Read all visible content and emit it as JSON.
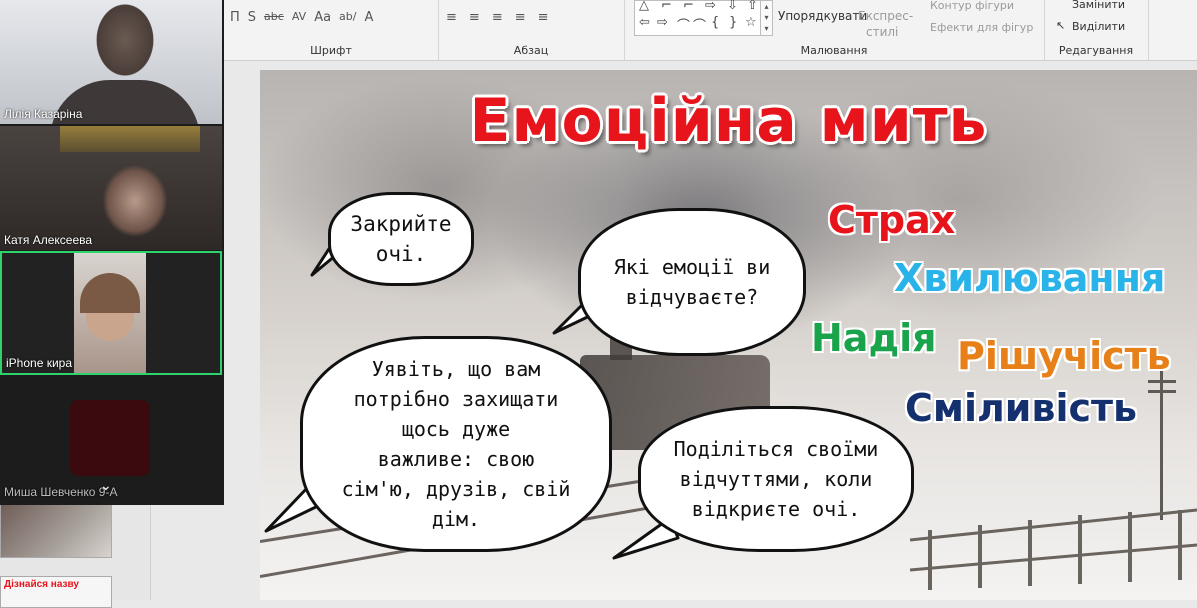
{
  "ribbon": {
    "font_tools": [
      "П",
      "S",
      "abc",
      "AV",
      "Aa",
      "ab/",
      "A"
    ],
    "para_tools": [
      "≡",
      "≡",
      "≡",
      "≡",
      "≡"
    ],
    "group_font": "Шрифт",
    "group_paragraph": "Абзац",
    "group_drawing": "Малювання",
    "group_editing": "Редагування",
    "arrange": "Упорядкувати",
    "styles_line1": "Експрес-",
    "styles_line2": "стилі",
    "outline": "Контур фігури",
    "effects": "Ефекти для фігур",
    "replace": "Замінити",
    "select": "Виділити",
    "shapes_glyphs": [
      "△",
      "⌐",
      "⌐",
      "⇨",
      "⇩",
      "⇧",
      "⇦",
      "⇨",
      "⌒",
      "⌒",
      "{",
      "}",
      "☆"
    ]
  },
  "slide": {
    "title": "Емоційна мить",
    "bubbles": {
      "close_eyes": [
        "Закрийте",
        "очі."
      ],
      "which_emotions": [
        "Які емоції ви",
        "відчуваєте?"
      ],
      "imagine": [
        "Уявіть, що вам",
        "потрібно захищати",
        "щось дуже",
        "важливе: свою",
        "сім'ю, друзів, свій",
        "дім."
      ],
      "share": [
        "Поділіться своїми",
        "відчуттями, коли",
        "відкриєте очі."
      ]
    },
    "emotions": {
      "fear": "Страх",
      "excitement": "Хвилювання",
      "hope": "Надія",
      "determination": "Рішучість",
      "courage": "Сміливість"
    },
    "colors": {
      "title": "#e8141c",
      "fear": "#e8141c",
      "excitement": "#29b3e8",
      "hope": "#19a34a",
      "determination": "#e8801a",
      "courage": "#14306e"
    }
  },
  "thumbnails": {
    "next_title": "Дізнайся назву"
  },
  "video": {
    "participants": [
      {
        "name": "Лілія Казаріна"
      },
      {
        "name": "Катя Алексеева"
      },
      {
        "name": "iPhone кира"
      },
      {
        "name": "Миша Шевченко 9-А"
      }
    ],
    "collapse_icon": "chevron-down-icon"
  }
}
